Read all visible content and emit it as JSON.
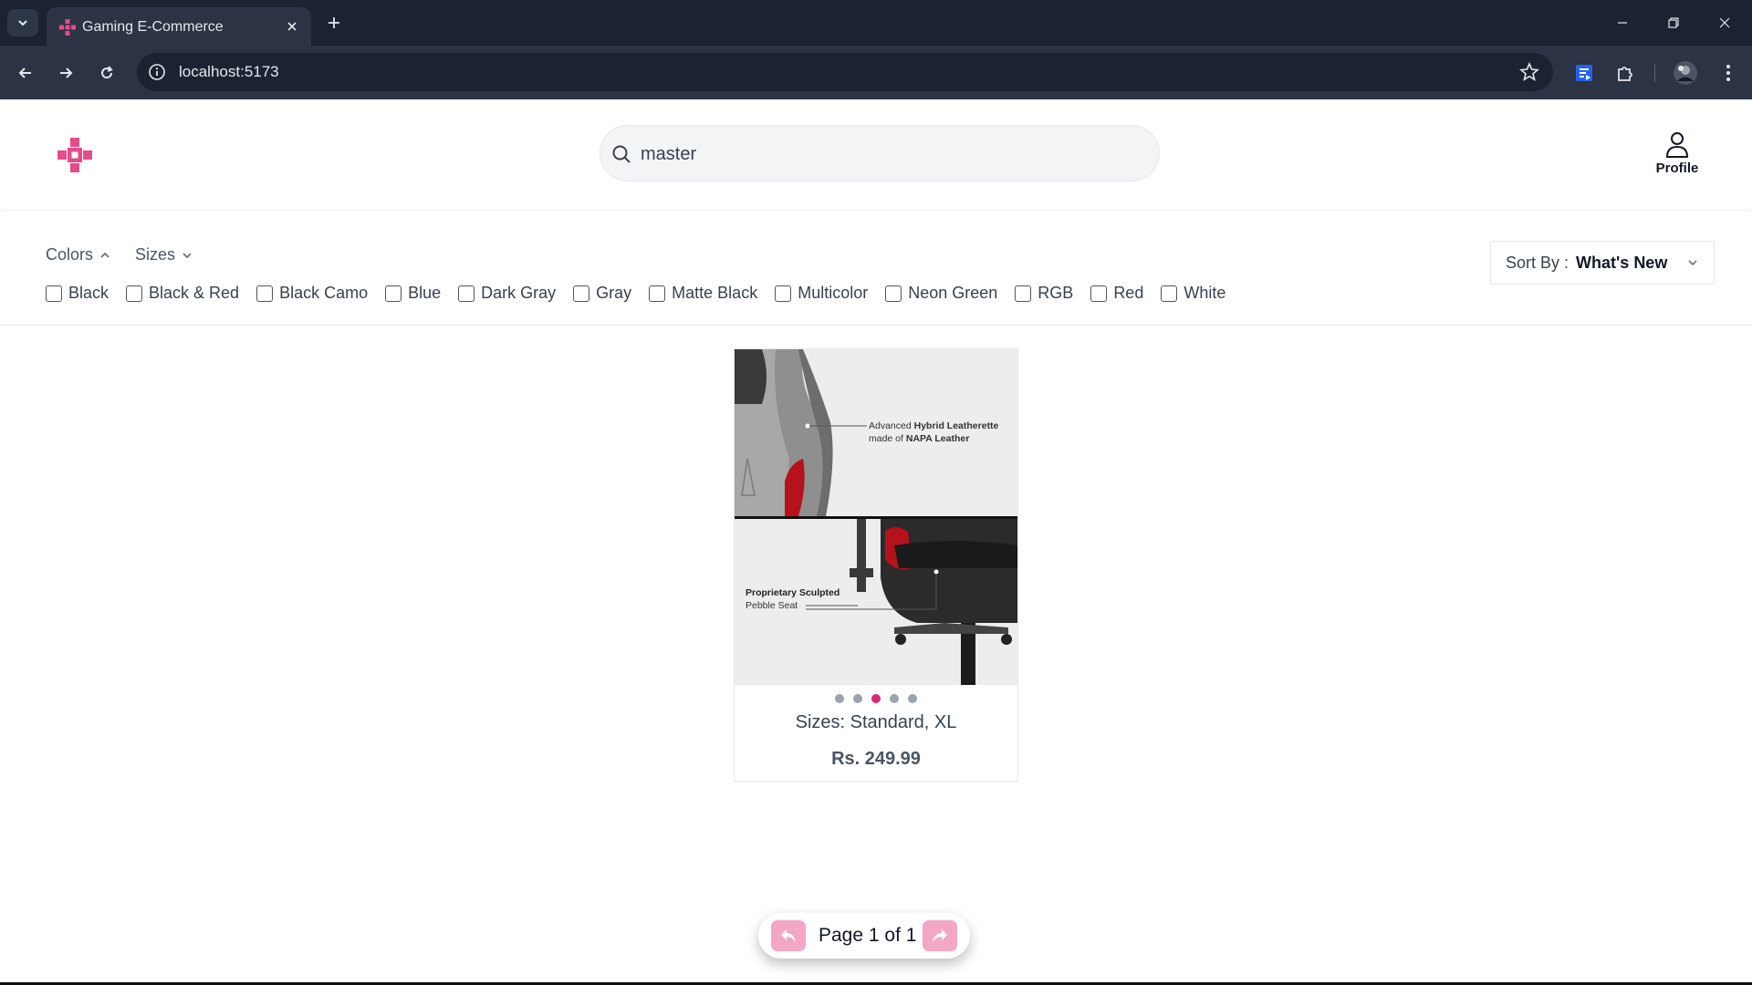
{
  "browser": {
    "tab_title": "Gaming E-Commerce",
    "url": "localhost:5173",
    "icons": [
      "tab-list-icon",
      "game-logo-icon",
      "close-icon",
      "plus-icon",
      "minimize-icon",
      "restore-icon",
      "window-close-icon",
      "back-arrow-icon",
      "forward-arrow-icon",
      "reload-icon",
      "site-info-icon",
      "star-icon",
      "extension-icon",
      "puzzle-icon",
      "avatar",
      "kebab-menu-icon"
    ]
  },
  "header": {
    "search_value": "master",
    "profile_label": "Profile",
    "brand_color": "#e84a8a"
  },
  "filters": {
    "colors_label": "Colors",
    "sizes_label": "Sizes",
    "colors_expanded": true,
    "color_options": [
      "Black",
      "Black & Red",
      "Black Camo",
      "Blue",
      "Dark Gray",
      "Gray",
      "Matte Black",
      "Multicolor",
      "Neon Green",
      "RGB",
      "Red",
      "White"
    ],
    "sort_label": "Sort By :",
    "sort_value": "What's New"
  },
  "product": {
    "image_text_top_1": "Advanced",
    "image_text_top_2": "Hybrid Leatherette",
    "image_text_top_3": "made of",
    "image_text_top_4": "NAPA Leather",
    "image_text_bottom_1": "Proprietary Sculpted",
    "image_text_bottom_2": "Pebble Seat",
    "carousel_dots": 5,
    "carousel_active": 3,
    "sizes": "Sizes: Standard, XL",
    "price": "Rs. 249.99",
    "accent_color": "#db2777"
  },
  "pagination": {
    "text": "Page 1 of 1",
    "button_color": "#f4a6c6"
  }
}
